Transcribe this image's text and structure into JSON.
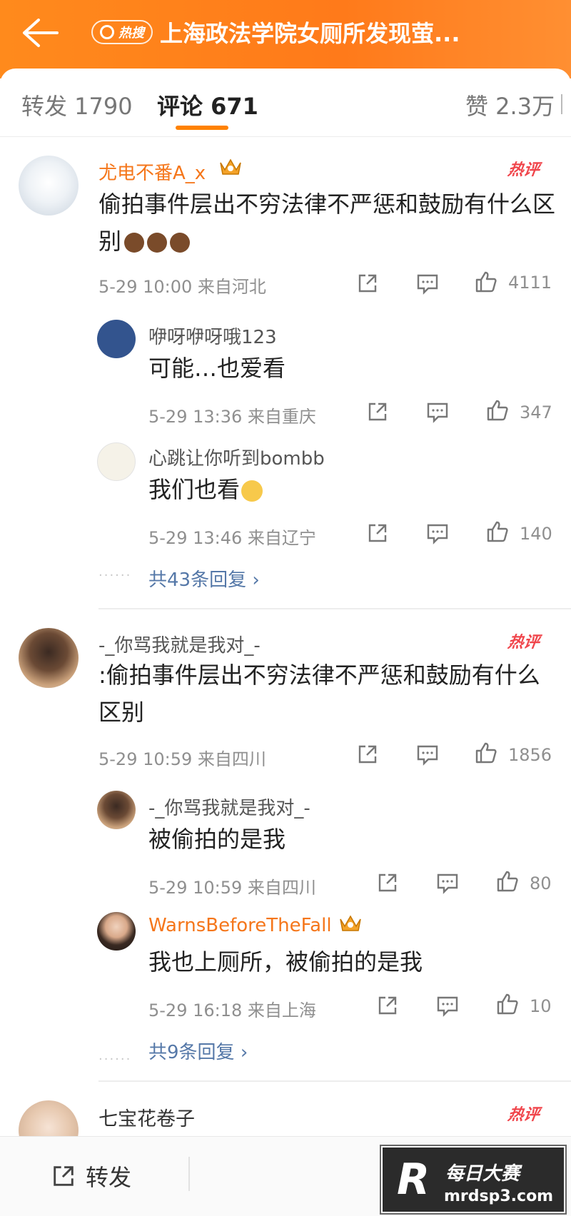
{
  "header": {
    "hot_tag": "热搜",
    "title": "上海政法学院女厕所发现萤..."
  },
  "tabs": {
    "repost": "转发 1790",
    "comments": "评论 671",
    "likes": "赞 2.3万"
  },
  "comments": [
    {
      "user": "尤电不番A_x",
      "text": "偷拍事件层出不穷法律不严惩和鼓励有什么区别",
      "time": "5-29 10:00",
      "location": "来自河北",
      "likes": "4111",
      "badge": "热评",
      "replies": [
        {
          "user": "咿呀咿呀哦123",
          "text": "可能…也爱看",
          "time": "5-29 13:36",
          "location": "来自重庆",
          "likes": "347"
        },
        {
          "user": "心跳让你听到bombb",
          "text": "我们也看",
          "time": "5-29 13:46",
          "location": "来自辽宁",
          "likes": "140"
        }
      ],
      "more": "共43条回复"
    },
    {
      "user": "-_你骂我就是我对_-",
      "text": ":偷拍事件层出不穷法律不严惩和鼓励有什么区别",
      "time": "5-29 10:59",
      "location": "来自四川",
      "likes": "1856",
      "badge": "热评",
      "replies": [
        {
          "user": "-_你骂我就是我对_-",
          "text": "被偷拍的是我",
          "time": "5-29 10:59",
          "location": "来自四川",
          "likes": "80"
        },
        {
          "user": "WarnsBeforeTheFall",
          "text": "我也上厕所，被偷拍的是我",
          "time": "5-29 16:18",
          "location": "来自上海",
          "likes": "10"
        }
      ],
      "more": "共9条回复"
    },
    {
      "user": "七宝花卷子",
      "badge": "热评"
    }
  ],
  "bottom": {
    "forward": "转发"
  },
  "watermark": {
    "letter": "R",
    "line1": "每日大赛",
    "line2": "mrdsp3.com"
  },
  "colors": {
    "header": "#ff7a1a",
    "accent": "#ff8200",
    "username_vip": "#f5761a",
    "hot_badge": "#f0454b",
    "link": "#5578a8"
  }
}
